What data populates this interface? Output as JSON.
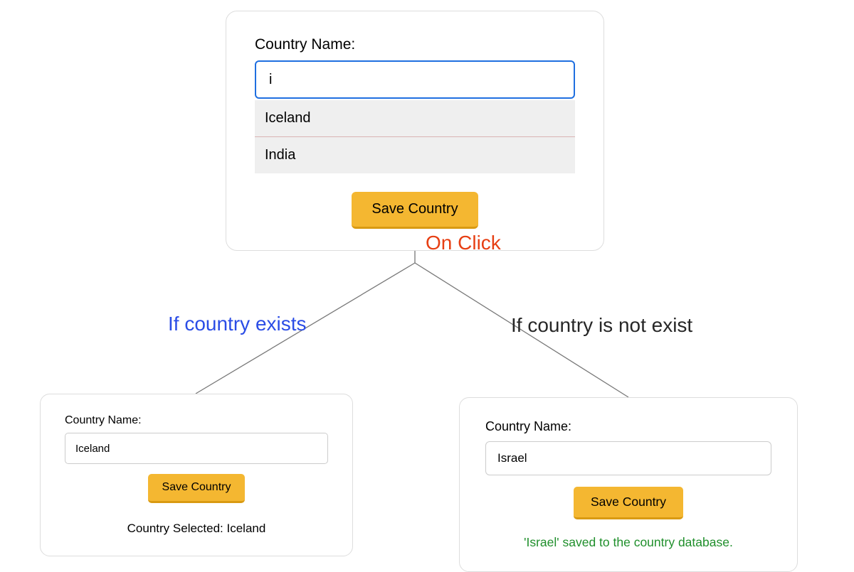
{
  "top": {
    "label": "Country Name:",
    "input_value": "i",
    "suggestions": [
      "Iceland",
      "India"
    ],
    "save_label": "Save Country"
  },
  "annotations": {
    "on_click": "On Click",
    "branch_exists": "If country exists",
    "branch_not_exists": "If country is not exist"
  },
  "left": {
    "label": "Country Name:",
    "input_value": "Iceland",
    "save_label": "Save Country",
    "result_text": "Country Selected: Iceland"
  },
  "right": {
    "label": "Country Name:",
    "input_value": "Israel",
    "save_label": "Save Country",
    "result_text": "'Israel' saved to the country database."
  },
  "colors": {
    "accent_button": "#f4b731",
    "input_focus_border": "#1f6fe0",
    "on_click_text": "#e73f13",
    "branch_exists_text": "#2b4de6",
    "success_text": "#1f8f2b"
  }
}
